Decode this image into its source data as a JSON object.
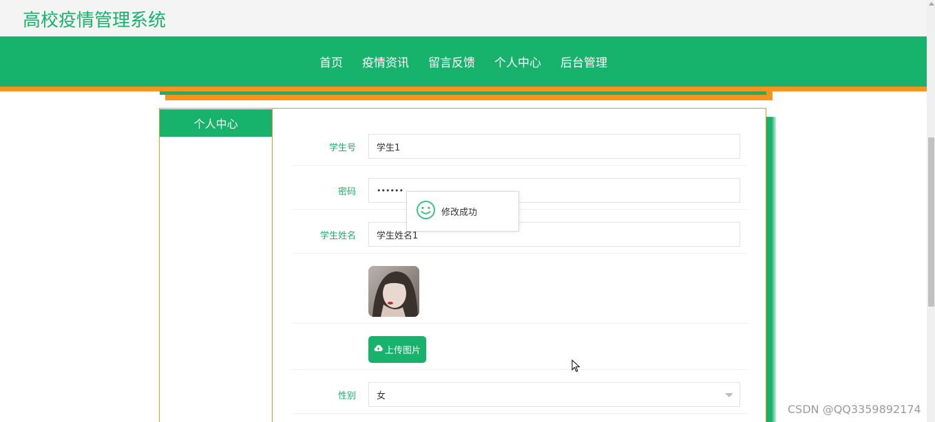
{
  "site": {
    "title": "高校疫情管理系统"
  },
  "nav": {
    "items": [
      {
        "label": "首页"
      },
      {
        "label": "疫情资讯"
      },
      {
        "label": "留言反馈"
      },
      {
        "label": "个人中心"
      },
      {
        "label": "后台管理"
      }
    ]
  },
  "sidebar": {
    "title": "个人中心"
  },
  "form": {
    "student_id": {
      "label": "学生号",
      "value": "学生1"
    },
    "password": {
      "label": "密码",
      "value": "••••••"
    },
    "student_name": {
      "label": "学生姓名",
      "value": "学生姓名1"
    },
    "upload_button": {
      "label": "上传图片",
      "icon": "cloud-upload-icon"
    },
    "gender": {
      "label": "性别",
      "value": "女"
    }
  },
  "toast": {
    "text": "修改成功",
    "icon": "smiley-icon"
  },
  "watermark": {
    "text": "CSDN @QQ3359892174"
  },
  "colors": {
    "brand_green": "#17b26b",
    "accent_orange": "#f7941d"
  }
}
